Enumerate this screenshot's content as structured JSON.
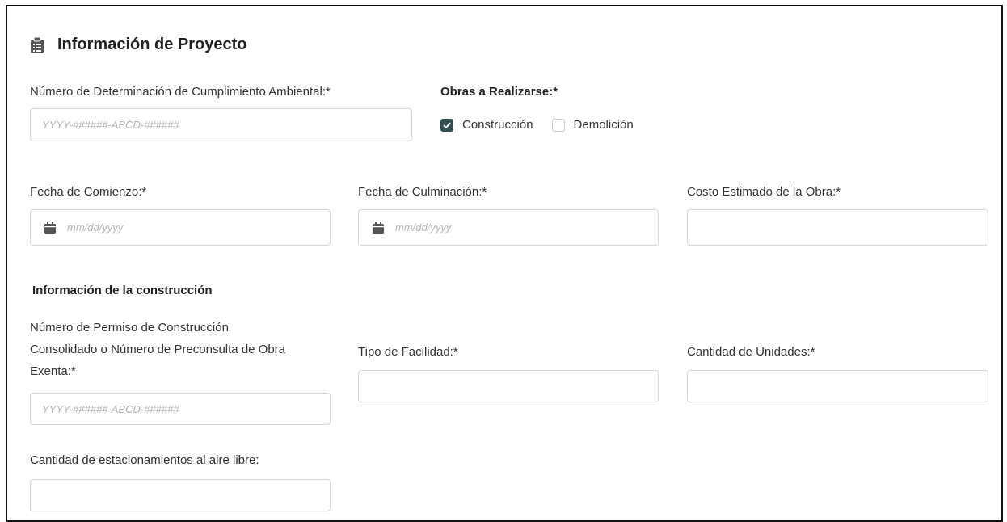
{
  "section": {
    "title": "Información de Proyecto",
    "icon": "clipboard-list-icon"
  },
  "fields": {
    "environmental_number": {
      "label": "Número de Determinación de Cumplimiento Ambiental:*",
      "placeholder": "YYYY-######-ABCD-######",
      "value": ""
    },
    "works": {
      "label": "Obras a Realizarse:*",
      "options": [
        {
          "label": "Construcción",
          "checked": true
        },
        {
          "label": "Demolición",
          "checked": false
        }
      ]
    },
    "start_date": {
      "label": "Fecha de Comienzo:*",
      "placeholder": "mm/dd/yyyy",
      "icon": "calendar-icon"
    },
    "end_date": {
      "label": "Fecha de Culminación:*",
      "placeholder": "mm/dd/yyyy",
      "icon": "calendar-icon"
    },
    "estimated_cost": {
      "label": "Costo Estimado de la Obra:*",
      "value": ""
    }
  },
  "construction": {
    "title": "Información de la construcción",
    "permit_number": {
      "label_lines": [
        "Número de Permiso de Construcción",
        "Consolidado o Número de Preconsulta de Obra",
        "Exenta:*"
      ],
      "placeholder": "YYYY-######-ABCD-######"
    },
    "facility_type": {
      "label": "Tipo de Facilidad:*",
      "value": ""
    },
    "units": {
      "label": "Cantidad de Unidades:*",
      "value": ""
    },
    "outdoor_parking": {
      "label": "Cantidad de estacionamientos al aire libre:",
      "value": ""
    }
  },
  "colors": {
    "checkbox_checked": "#2f4f4f",
    "input_border": "#d6d6d6",
    "placeholder": "#b5b5b5",
    "frame_border": "#111111"
  }
}
